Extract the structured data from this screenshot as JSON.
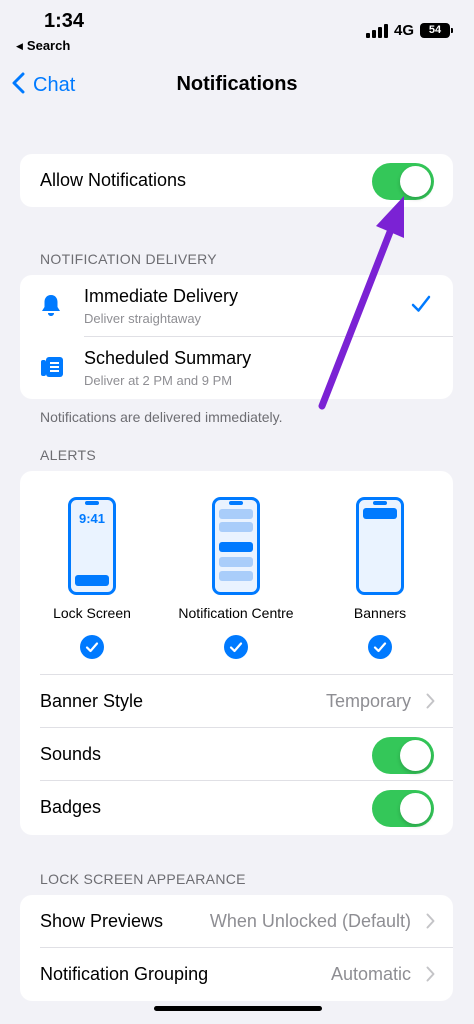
{
  "status_bar": {
    "time": "1:34",
    "back_app": "Search",
    "network": "4G",
    "battery": "54"
  },
  "nav": {
    "back_label": "Chat",
    "title": "Notifications"
  },
  "allow_notifications": {
    "label": "Allow Notifications",
    "on": true
  },
  "delivery": {
    "header": "NOTIFICATION DELIVERY",
    "options": [
      {
        "title": "Immediate Delivery",
        "subtitle": "Deliver straightaway",
        "icon": "bell-icon",
        "selected": true
      },
      {
        "title": "Scheduled Summary",
        "subtitle": "Deliver at 2 PM and 9 PM",
        "icon": "summary-icon",
        "selected": false
      }
    ],
    "footer": "Notifications are delivered immediately."
  },
  "alerts": {
    "header": "ALERTS",
    "options": [
      {
        "label": "Lock Screen",
        "preview_time": "9:41",
        "checked": true
      },
      {
        "label": "Notification Centre",
        "checked": true
      },
      {
        "label": "Banners",
        "checked": true
      }
    ],
    "banner_style": {
      "label": "Banner Style",
      "value": "Temporary"
    },
    "sounds": {
      "label": "Sounds",
      "on": true
    },
    "badges": {
      "label": "Badges",
      "on": true
    }
  },
  "lock_screen": {
    "header": "LOCK SCREEN APPEARANCE",
    "show_previews": {
      "label": "Show Previews",
      "value": "When Unlocked (Default)"
    },
    "grouping": {
      "label": "Notification Grouping",
      "value": "Automatic"
    }
  },
  "colors": {
    "accent": "#007aff",
    "toggle_on": "#34c759",
    "annotation_arrow": "#7b22d4"
  }
}
